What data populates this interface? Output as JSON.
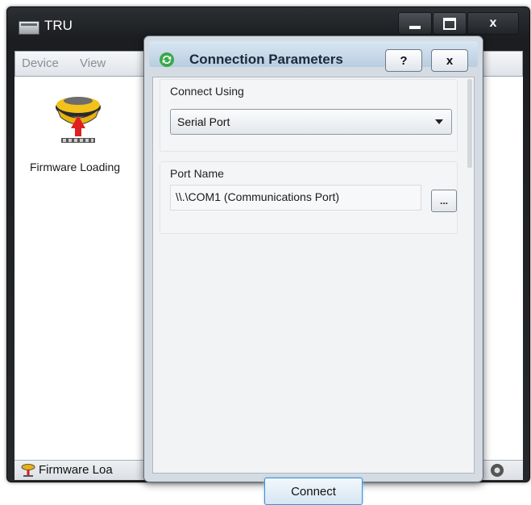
{
  "window": {
    "title": "TRU",
    "close_glyph": "x",
    "menu": [
      "Device",
      "View"
    ],
    "device_item": {
      "label": "Firmware Loading",
      "icon": "gnss-receiver-icon"
    },
    "status": {
      "text": "Firmware Loa",
      "icon": "gnss-receiver-icon"
    }
  },
  "dialog": {
    "title": "Connection Parameters",
    "help_label": "?",
    "close_label": "x",
    "connect_using": {
      "label": "Connect Using",
      "selected": "Serial Port"
    },
    "port_name": {
      "label": "Port Name",
      "value": "\\\\.\\COM1 (Communications Port)",
      "browse_label": "..."
    },
    "connect_button": "Connect"
  },
  "colors": {
    "window_chrome": "#1f2225",
    "dialog_title_bg": "#c7d8ea",
    "accent_focus": "#3f8fd0"
  }
}
